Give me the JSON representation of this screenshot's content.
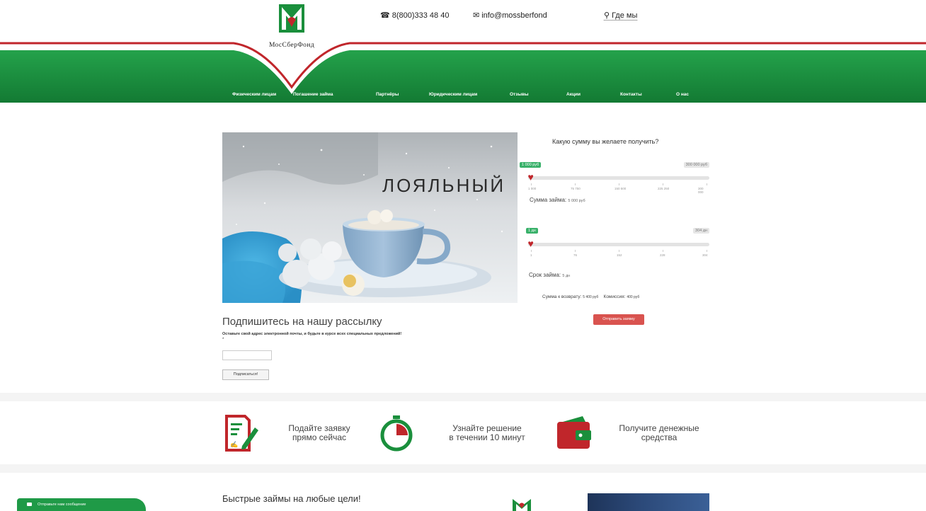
{
  "header": {
    "logo_text": "МосСберФонд",
    "phone": "8(800)333 48 40",
    "email": "info@mossberfond",
    "where": "Где мы"
  },
  "nav": {
    "items": [
      "Физическим лицам",
      "Погашение займа",
      "Партнёры",
      "Юридическим лицам",
      "Отзывы",
      "Акции",
      "Контакты",
      "О нас"
    ]
  },
  "banner": {
    "title": "ЛОЯЛЬНЫЙ"
  },
  "calculator": {
    "title": "Какую сумму вы желаете получить?",
    "amount": {
      "min_label": "1 000 руб",
      "max_label": "300 000 руб",
      "ticks": [
        "1 000",
        "75 750",
        "150 500",
        "225 250",
        "300 000"
      ],
      "value_label": "Сумма займа:",
      "value": "5 000 руб",
      "level": 0.01
    },
    "term": {
      "min_label": "1 дн",
      "max_label": "304 дн",
      "ticks": [
        "1",
        "76",
        "152",
        "228",
        "304"
      ],
      "value_label": "Срок займа:",
      "value": "5 дн",
      "level": 0.01
    },
    "summary": {
      "return_label": "Сумма к возврату:",
      "return_value": "5 400 руб",
      "commission_label": "Комиссия:",
      "commission_value": "400 руб"
    },
    "apply_button": "Отправить заявку"
  },
  "subscribe": {
    "title": "Подпишитесь на нашу рассылку",
    "description": "Оставьте свой адрес электронной почты, и будьте в курсе всех специальных предложений!",
    "required_mark": "*",
    "input_value": "",
    "button": "Подписаться!"
  },
  "steps": [
    {
      "line1": "Подайте заявку",
      "line2": "прямо сейчас"
    },
    {
      "line1": "Узнайте решение",
      "line2": "в течении 10 минут"
    },
    {
      "line1": "Получите денежные",
      "line2": "средства"
    }
  ],
  "bottom": {
    "title": "Быстрые займы на любые цели!"
  },
  "chat": {
    "label": "Отправьте нам сообщение"
  },
  "colors": {
    "brand_green": "#1a8f3c",
    "brand_red": "#c0262b",
    "accent_green": "#39b16a",
    "button_red": "#d9534f"
  },
  "icons": {
    "phone": "phone-icon",
    "mail": "mail-icon",
    "location": "location-pin-icon",
    "application": "application-form-icon",
    "timer": "stopwatch-icon",
    "wallet": "wallet-icon",
    "chat": "chat-icon"
  }
}
